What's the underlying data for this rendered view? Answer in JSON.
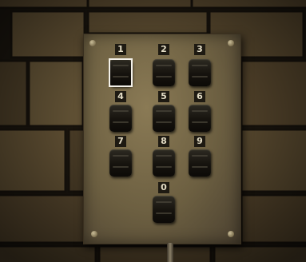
{
  "keypad": {
    "keys": [
      {
        "digit": "1"
      },
      {
        "digit": "2"
      },
      {
        "digit": "3"
      },
      {
        "digit": "4"
      },
      {
        "digit": "5"
      },
      {
        "digit": "6"
      },
      {
        "digit": "7"
      },
      {
        "digit": "8"
      },
      {
        "digit": "9"
      },
      {
        "digit": "0"
      }
    ],
    "selected_digit": "1"
  },
  "colors": {
    "panel": "#6c5f41",
    "key": "#16130e",
    "digit_label_bg": "#1e1a12",
    "digit_label_text": "#e3dcc5",
    "selector": "#f4f1ea",
    "mortar": "#231d13"
  }
}
